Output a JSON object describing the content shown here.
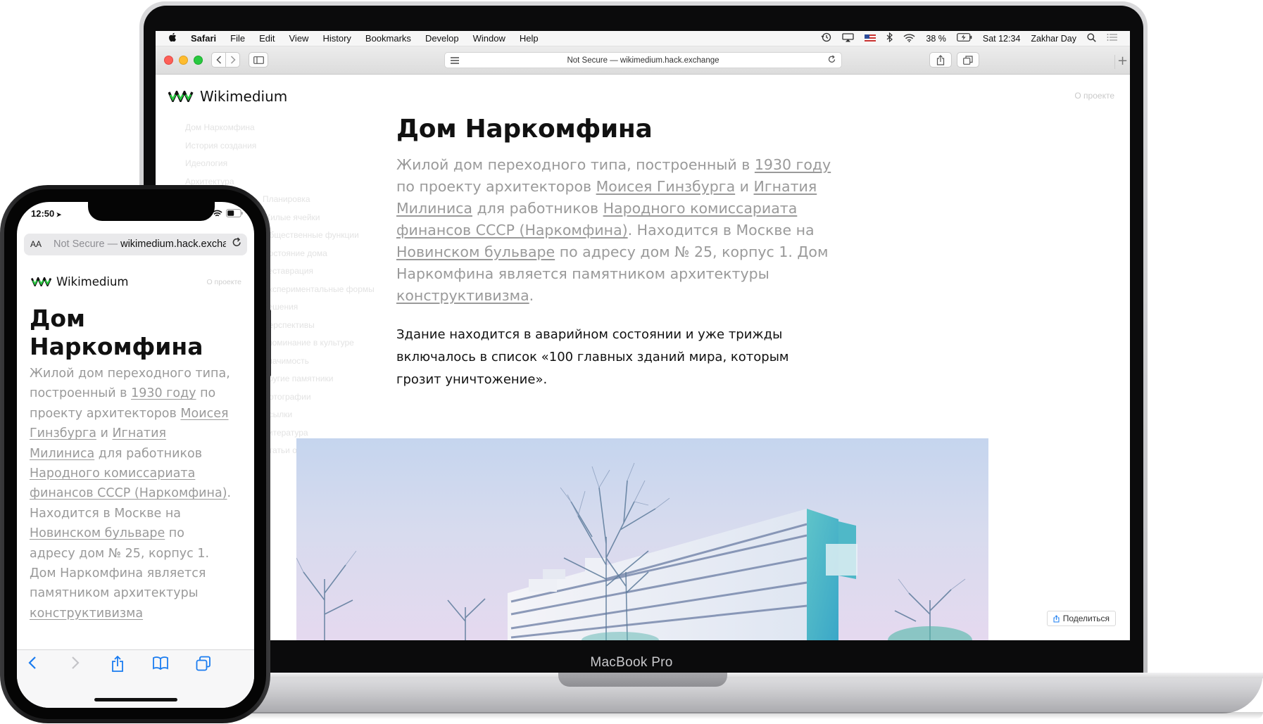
{
  "device_label": "MacBook Pro",
  "mac": {
    "menubar": {
      "app": "Safari",
      "menus": [
        "File",
        "Edit",
        "View",
        "History",
        "Bookmarks",
        "Develop",
        "Window",
        "Help"
      ],
      "battery": "38 %",
      "clock": "Sat 12:34",
      "user": "Zakhar Day"
    },
    "address_bar": "Not Secure — wikimedium.hack.exchange"
  },
  "site": {
    "logo_text": "Wikimedium",
    "about_link": "О проекте",
    "toc": [
      "Дом Наркомфина",
      "История создания",
      "Идеология",
      "Архитектура",
      "Планировка",
      "Жилые ячейки",
      "Общественные функции",
      "Состояние дома",
      "Реставрация",
      "Экспериментальные формы",
      "Решения",
      "Перспективы",
      "Упоминание в культуре",
      "Значимость",
      "Другие памятники",
      "Фотографии",
      "Ссылки",
      "Литература",
      "Статьи о Доме"
    ],
    "title": "Дом Наркомфина",
    "lead": {
      "t1": "Жилой дом переходного типа, построенный в ",
      "l1": "1930 году",
      "t2": " по проекту архитекторов ",
      "l2": "Моисея Гинзбурга",
      "t3": " и ",
      "l3": "Игнатия Милиниса",
      "t4": " для работников ",
      "l4": "Народного комиссариата финансов СССР (Наркомфина)",
      "t5": ". Находится в Москве на ",
      "l5": "Новинском бульваре",
      "t6": " по адресу дом № 25, корпус 1. Дом Наркомфина является памятником архитектуры ",
      "l6": "конструктивизма",
      "t7": "."
    },
    "body": "Здание находится в аварийном состоянии и уже трижды включалось в список «100 главных зданий мира, которым грозит уничтожение».",
    "share_button": "Поделиться"
  },
  "iphone": {
    "time": "12:50",
    "url_prefix": "Not Secure — ",
    "url_host": "wikimedium.hack.exchange",
    "aa_label": "AA",
    "title": "Дом Наркомфина",
    "lead_cut": {
      "t1": "Жилой дом переходного типа, построенный в ",
      "l1": "1930 году",
      "t2": " по проекту архитекторов ",
      "l2": "Моисея Гинзбурга",
      "t3": " и ",
      "l3": "Игнатия Милиниса",
      "t4": " для работников ",
      "l4": "Народного комиссариата финансов СССР (Наркомфина)",
      "t5": ". Находится в Москве на ",
      "l5": "Новинском бульваре",
      "t6": " по адресу дом № 25, корпус 1. Дом Наркомфина является памятником архитектуры ",
      "l6": "конструктивизма"
    },
    "toolbar_icons": [
      "back-icon",
      "forward-icon",
      "share-icon",
      "bookmarks-icon",
      "tabs-icon"
    ]
  },
  "colors": {
    "logo_green": "#27c93f",
    "link_gray": "#9a9a9a",
    "ios_blue": "#1a7cf0"
  }
}
